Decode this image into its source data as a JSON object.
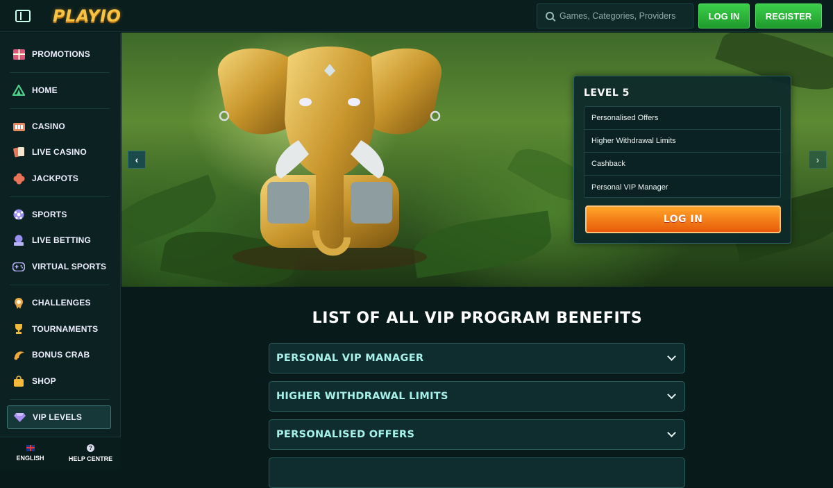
{
  "header": {
    "logo": "PLAYIO",
    "search_placeholder": "Games, Categories, Providers",
    "login_label": "LOG IN",
    "register_label": "REGISTER"
  },
  "sidebar": {
    "items": [
      {
        "label": "PROMOTIONS",
        "icon": "gift-icon"
      },
      {
        "label": "HOME",
        "icon": "home-icon"
      },
      {
        "label": "CASINO",
        "icon": "casino-icon"
      },
      {
        "label": "LIVE CASINO",
        "icon": "cards-icon"
      },
      {
        "label": "JACKPOTS",
        "icon": "clover-icon"
      },
      {
        "label": "SPORTS",
        "icon": "football-icon"
      },
      {
        "label": "LIVE BETTING",
        "icon": "live-icon"
      },
      {
        "label": "VIRTUAL SPORTS",
        "icon": "gamepad-icon"
      },
      {
        "label": "CHALLENGES",
        "icon": "medal-icon"
      },
      {
        "label": "TOURNAMENTS",
        "icon": "trophy-icon"
      },
      {
        "label": "BONUS CRAB",
        "icon": "crab-icon"
      },
      {
        "label": "SHOP",
        "icon": "bag-icon"
      },
      {
        "label": "VIP LEVELS",
        "icon": "diamond-icon"
      }
    ],
    "language_label": "ENGLISH",
    "help_label": "HELP CENTRE"
  },
  "hero": {
    "level_title": "LEVEL 5",
    "benefits": [
      "Personalised Offers",
      "Higher Withdrawal Limits",
      "Cashback",
      "Personal VIP Manager"
    ],
    "login_label": "LOG IN"
  },
  "main": {
    "title": "LIST OF ALL VIP PROGRAM BENEFITS",
    "accordion": [
      "PERSONAL VIP MANAGER",
      "HIGHER WITHDRAWAL LIMITS",
      "PERSONALISED OFFERS"
    ]
  }
}
